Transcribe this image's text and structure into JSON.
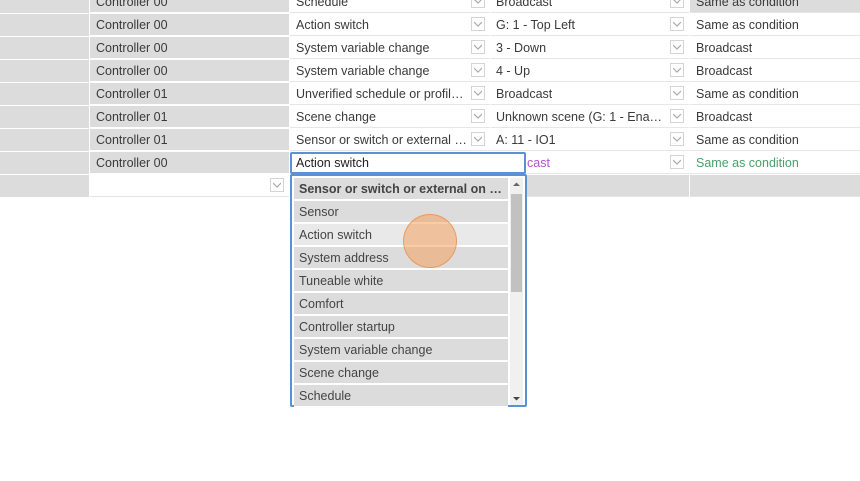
{
  "table": {
    "rows": [
      {
        "controller": "Controller 00",
        "event": "Schedule",
        "target": "Broadcast",
        "apply_to": "Same as condition"
      },
      {
        "controller": "Controller 00",
        "event": "Action switch",
        "target": "G: 1 - Top Left",
        "apply_to": "Same as condition"
      },
      {
        "controller": "Controller 00",
        "event": "System variable change",
        "target": "3 - Down",
        "apply_to": "Broadcast"
      },
      {
        "controller": "Controller 00",
        "event": "System variable change",
        "target": "4 - Up",
        "apply_to": "Broadcast"
      },
      {
        "controller": "Controller 01",
        "event": "Unverified schedule or profile e…",
        "target": "Broadcast",
        "apply_to": "Same as condition"
      },
      {
        "controller": "Controller 01",
        "event": "Scene change",
        "target": "Unknown scene (G: 1 - Enable …",
        "apply_to": "Broadcast"
      },
      {
        "controller": "Controller 01",
        "event": "Sensor or switch or external on…",
        "target": "A: 11 - IO1",
        "apply_to": "Same as condition"
      }
    ],
    "edit_row": {
      "controller": "Controller 00",
      "event_value": "Action switch",
      "target_partial": "cast",
      "apply_to": "Same as condition"
    }
  },
  "dropdown": {
    "options": [
      "Sensor or switch or external on co…",
      "Sensor",
      "Action switch",
      "System address",
      "Tuneable white",
      "Comfort",
      "Controller startup",
      "System variable change",
      "Scene change",
      "Schedule"
    ],
    "hovered": "Action switch"
  },
  "colors": {
    "accent": "#5b8fd6",
    "cell_gray": "#dcdcdc",
    "target_magenta": "#b055c8",
    "apply_green": "#4a9f6a",
    "cursor": "#f4a05f"
  }
}
